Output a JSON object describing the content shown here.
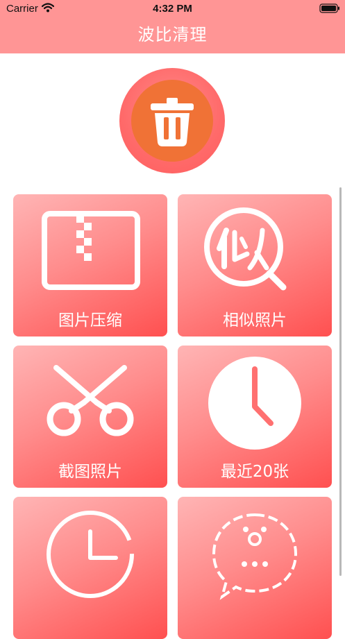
{
  "status_bar": {
    "carrier": "Carrier",
    "time": "4:32 PM"
  },
  "header": {
    "title": "波比清理"
  },
  "clean_button": {
    "icon": "trash-icon"
  },
  "tiles": [
    {
      "label": "图片压缩",
      "icon": "zip-archive-icon"
    },
    {
      "label": "相似照片",
      "icon": "similar-search-icon"
    },
    {
      "label": "截图照片",
      "icon": "scissors-icon"
    },
    {
      "label": "最近20张",
      "icon": "clock-icon"
    },
    {
      "label": "",
      "icon": "clock-outline-icon"
    },
    {
      "label": "",
      "icon": "chat-bubble-icon"
    }
  ],
  "colors": {
    "header": "#ff9595",
    "accent_orange": "#f07236",
    "tile_gradient_start": "#ffb5b5",
    "tile_gradient_end": "#ff5050"
  }
}
